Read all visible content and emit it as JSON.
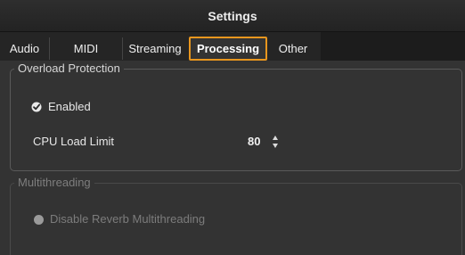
{
  "window": {
    "title": "Settings"
  },
  "tabs": [
    {
      "label": "Audio"
    },
    {
      "label": "MIDI"
    },
    {
      "label": "Streaming"
    },
    {
      "label": "Processing",
      "active": true
    },
    {
      "label": "Other"
    }
  ],
  "overload_protection": {
    "legend": "Overload Protection",
    "enabled_label": "Enabled",
    "enabled_checked": true,
    "cpu_limit_label": "CPU Load Limit",
    "cpu_limit_value": "80"
  },
  "multithreading": {
    "legend": "Multithreading",
    "disable_reverb_label": "Disable Reverb Multithreading",
    "disabled": true
  },
  "colors": {
    "accent": "#e8961e",
    "background": "#333333",
    "titlebar": "#262626"
  }
}
